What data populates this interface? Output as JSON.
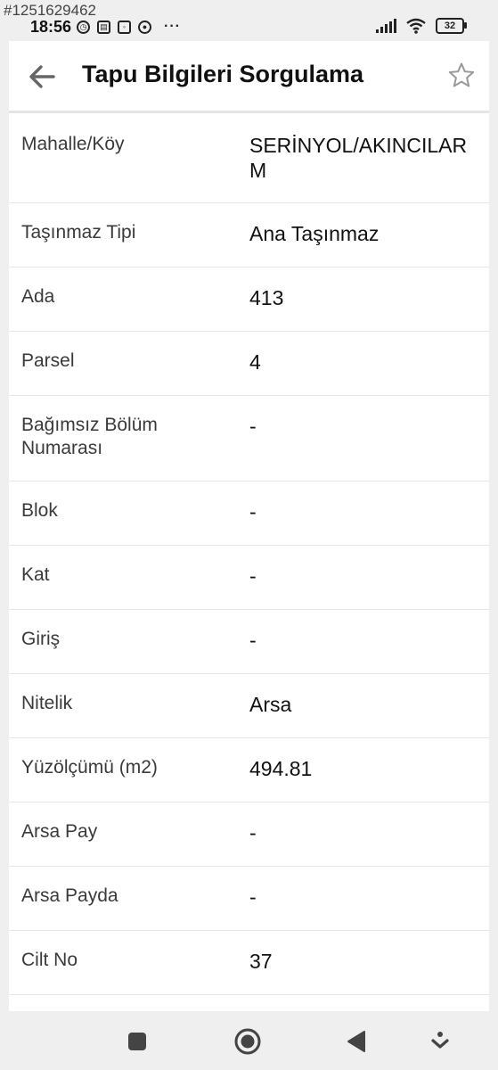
{
  "watermark": "#1251629462",
  "status": {
    "time": "18:56",
    "battery": "32",
    "left_icons": [
      "alarm-icon",
      "calendar-icon",
      "instagram-icon",
      "soccer-ball-icon"
    ],
    "more": "···"
  },
  "header": {
    "title": "Tapu Bilgileri Sorgulama"
  },
  "rows": [
    {
      "label": "Mahalle/Köy",
      "value": "SERİNYOL/AKINCILARM"
    },
    {
      "label": "Taşınmaz Tipi",
      "value": "Ana Taşınmaz"
    },
    {
      "label": "Ada",
      "value": "413"
    },
    {
      "label": "Parsel",
      "value": "4"
    },
    {
      "label": "Bağımsız Bölüm Numarası",
      "value": "-"
    },
    {
      "label": "Blok",
      "value": "-"
    },
    {
      "label": "Kat",
      "value": "-"
    },
    {
      "label": "Giriş",
      "value": "-"
    },
    {
      "label": "Nitelik",
      "value": "Arsa"
    },
    {
      "label": "Yüzölçümü (m2)",
      "value": "494.81"
    },
    {
      "label": "Arsa Pay",
      "value": "-"
    },
    {
      "label": "Arsa Payda",
      "value": "-"
    },
    {
      "label": "Cilt No",
      "value": "37"
    }
  ],
  "colors": {
    "background": "#efefef",
    "surface": "#ffffff",
    "divider": "#e6e6e6"
  }
}
